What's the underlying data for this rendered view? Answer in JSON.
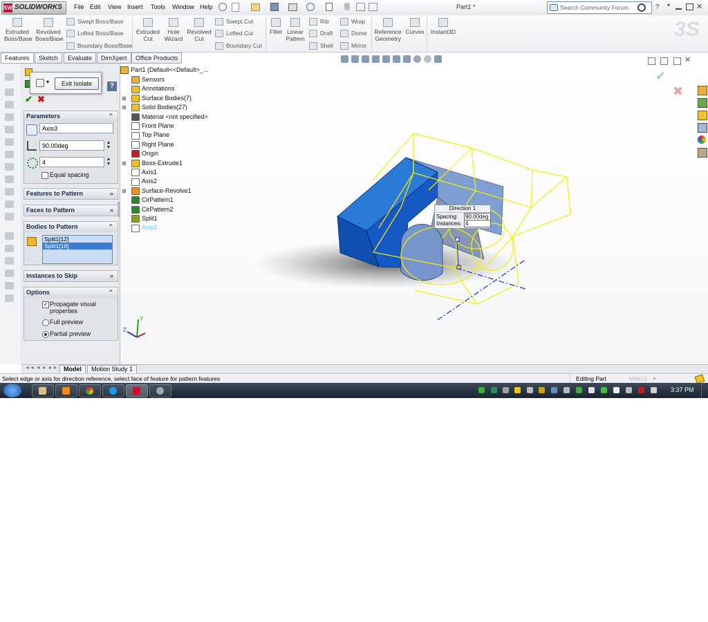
{
  "app": {
    "logo_text": "SOLIDWORKS",
    "doc_title": "Part1 *"
  },
  "menu": [
    "File",
    "Edit",
    "View",
    "Insert",
    "Tools",
    "Window",
    "Help"
  ],
  "search": {
    "placeholder": "Search Community Forum"
  },
  "command_manager": {
    "extruded_boss": "Extruded Boss/Base",
    "revolved_boss": "Revolved Boss/Base",
    "swept_boss": "Swept Boss/Base",
    "lofted_boss": "Lofted Boss/Base",
    "boundary_boss": "Boundary Boss/Base",
    "extruded_cut": "Extruded Cut",
    "hole_wizard": "Hole Wizard",
    "revolved_cut": "Revolved Cut",
    "swept_cut": "Swept Cut",
    "lofted_cut": "Lofted Cut",
    "boundary_cut": "Boundary Cut",
    "fillet": "Fillet",
    "linear_pattern": "Linear Pattern",
    "rib": "Rib",
    "draft": "Draft",
    "shell": "Shell",
    "wrap": "Wrap",
    "dome": "Dome",
    "mirror": "Mirror",
    "reference_geometry": "Reference Geometry",
    "curves": "Curves",
    "instant3d": "Instant3D"
  },
  "tabs": [
    "Features",
    "Sketch",
    "Evaluate",
    "DimXpert",
    "Office Products"
  ],
  "popup": {
    "exit_isolate": "Exit Isolate",
    "help": "?"
  },
  "property_manager": {
    "parameters": {
      "title": "Parameters",
      "axis": "Axis3",
      "angle": "90.00deg",
      "instances": "4",
      "equal_spacing": "Equal spacing",
      "equal_spacing_checked": false
    },
    "features_to_pattern": "Features to Pattern",
    "faces_to_pattern": "Faces to Pattern",
    "bodies_to_pattern": {
      "title": "Bodies to Pattern",
      "items": [
        "Split1[12]",
        "Split1[18]"
      ]
    },
    "instances_to_skip": "Instances to Skip",
    "options": {
      "title": "Options",
      "propagate_visual": "Propagate visual properties",
      "propagate_checked": true,
      "full_preview": "Full preview",
      "partial_preview": "Partial preview",
      "selected_preview": "Partial preview"
    }
  },
  "feature_tree": {
    "root": "Part1  (Default<<Default>_...",
    "items": [
      {
        "label": "Sensors",
        "icon": "sensors-icon"
      },
      {
        "label": "Annotations",
        "icon": "annotations-icon"
      },
      {
        "label": "Surface Bodies(7)",
        "icon": "surface-bodies-icon"
      },
      {
        "label": "Solid Bodies(27)",
        "icon": "solid-bodies-icon"
      },
      {
        "label": "Material <not specified>",
        "icon": "material-icon"
      },
      {
        "label": "Front Plane",
        "icon": "plane-icon"
      },
      {
        "label": "Top Plane",
        "icon": "plane-icon"
      },
      {
        "label": "Right Plane",
        "icon": "plane-icon"
      },
      {
        "label": "Origin",
        "icon": "origin-icon"
      },
      {
        "label": "Boss-Extrude1",
        "icon": "boss-extrude-icon"
      },
      {
        "label": "Axis1",
        "icon": "axis-icon"
      },
      {
        "label": "Axis2",
        "icon": "axis-icon"
      },
      {
        "label": "Surface-Revolve1",
        "icon": "surface-revolve-icon"
      },
      {
        "label": "CirPattern1",
        "icon": "circular-pattern-icon"
      },
      {
        "label": "CirPattern2",
        "icon": "circular-pattern-icon"
      },
      {
        "label": "Split1",
        "icon": "split-icon"
      },
      {
        "label": "Axis3",
        "icon": "axis-icon"
      }
    ]
  },
  "callout": {
    "title": "Direction 1",
    "spacing_label": "Spacing:",
    "spacing_value": "90.00deg",
    "instances_label": "Instances:",
    "instances_value": "4"
  },
  "triad": {
    "y": "Y",
    "z": "Z"
  },
  "bottom_tabs": [
    "Model",
    "Motion Study 1"
  ],
  "status": {
    "message": "Select edge or axis for direction reference, select face of feature for pattern features",
    "mode": "Editing Part",
    "units": "MMGS"
  },
  "taskbar": {
    "time": "3:37 PM"
  },
  "colors": {
    "accent": "#1a5fb4",
    "preview": "#f5f000",
    "axis": "#1a2fc8"
  }
}
